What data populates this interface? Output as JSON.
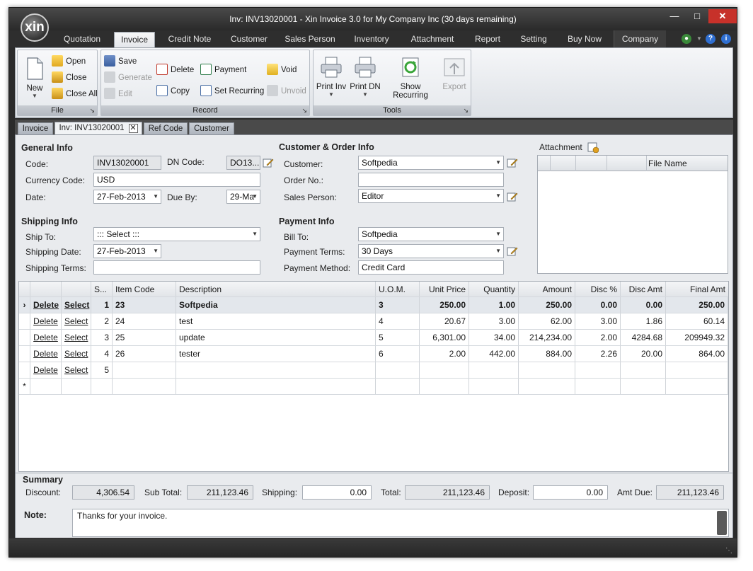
{
  "window": {
    "title": "Inv: INV13020001 - Xin Invoice 3.0 for My Company Inc (30 days remaining)",
    "logo_text": "xin"
  },
  "menu_tabs": [
    "Quotation",
    "Invoice",
    "Credit Note",
    "Customer",
    "Sales Person",
    "Inventory",
    "Attachment",
    "Report",
    "Setting",
    "Buy Now",
    "Company"
  ],
  "ribbon": {
    "file": {
      "label": "File",
      "new": "New",
      "open": "Open",
      "close": "Close",
      "close_all": "Close All"
    },
    "record": {
      "label": "Record",
      "save": "Save",
      "generate": "Generate",
      "edit": "Edit",
      "delete": "Delete",
      "copy": "Copy",
      "payment": "Payment",
      "set_recurring": "Set Recurring",
      "void": "Void",
      "unvoid": "Unvoid"
    },
    "tools": {
      "label": "Tools",
      "print_inv": "Print Inv",
      "print_dn": "Print DN",
      "show_recurring": "Show Recurring",
      "export": "Export"
    }
  },
  "doc_tabs": [
    "Invoice",
    "Inv: INV13020001",
    "Ref Code",
    "Customer"
  ],
  "general_info": {
    "title": "General Info",
    "code_label": "Code:",
    "code": "INV13020001",
    "dn_code_label": "DN Code:",
    "dn_code": "DO13...",
    "currency_label": "Currency Code:",
    "currency": "USD",
    "date_label": "Date:",
    "date": "27-Feb-2013",
    "due_by_label": "Due By:",
    "due_by": "29-Ma"
  },
  "shipping_info": {
    "title": "Shipping Info",
    "ship_to_label": "Ship To:",
    "ship_to": "::: Select :::",
    "shipping_date_label": "Shipping Date:",
    "shipping_date": "27-Feb-2013",
    "shipping_terms_label": "Shipping Terms:",
    "shipping_terms": ""
  },
  "customer_order": {
    "title": "Customer & Order Info",
    "customer_label": "Customer:",
    "customer": "Softpedia",
    "order_no_label": "Order No.:",
    "order_no": "",
    "sales_person_label": "Sales Person:",
    "sales_person": "Editor"
  },
  "payment_info": {
    "title": "Payment Info",
    "bill_to_label": "Bill To:",
    "bill_to": "Softpedia",
    "payment_terms_label": "Payment Terms:",
    "payment_terms": "30 Days",
    "payment_method_label": "Payment Method:",
    "payment_method": "Credit Card"
  },
  "attachment": {
    "label": "Attachment",
    "file_name_col": "File Name"
  },
  "grid": {
    "columns": [
      "",
      "",
      "",
      "S...",
      "Item Code",
      "Description",
      "U.O.M.",
      "Unit Price",
      "Quantity",
      "Amount",
      "Disc %",
      "Disc Amt",
      "Final Amt"
    ],
    "delete_label": "Delete",
    "select_label": "Select",
    "rows": [
      {
        "seq": "1",
        "item_code": "23",
        "description": "Softpedia",
        "uom": "3",
        "unit_price": "250.00",
        "quantity": "1.00",
        "amount": "250.00",
        "disc_pct": "0.00",
        "disc_amt": "0.00",
        "final_amt": "250.00"
      },
      {
        "seq": "2",
        "item_code": "24",
        "description": "test",
        "uom": "4",
        "unit_price": "20.67",
        "quantity": "3.00",
        "amount": "62.00",
        "disc_pct": "3.00",
        "disc_amt": "1.86",
        "final_amt": "60.14"
      },
      {
        "seq": "3",
        "item_code": "25",
        "description": "update",
        "uom": "5",
        "unit_price": "6,301.00",
        "quantity": "34.00",
        "amount": "214,234.00",
        "disc_pct": "2.00",
        "disc_amt": "4284.68",
        "final_amt": "209949.32"
      },
      {
        "seq": "4",
        "item_code": "26",
        "description": "tester",
        "uom": "6",
        "unit_price": "2.00",
        "quantity": "442.00",
        "amount": "884.00",
        "disc_pct": "2.26",
        "disc_amt": "20.00",
        "final_amt": "864.00"
      },
      {
        "seq": "5",
        "item_code": "",
        "description": "",
        "uom": "",
        "unit_price": "",
        "quantity": "",
        "amount": "",
        "disc_pct": "",
        "disc_amt": "",
        "final_amt": ""
      }
    ],
    "new_row_marker": "*",
    "current_row_marker": "›"
  },
  "summary": {
    "title": "Summary",
    "discount_label": "Discount:",
    "discount": "4,306.54",
    "sub_total_label": "Sub Total:",
    "sub_total": "211,123.46",
    "shipping_label": "Shipping:",
    "shipping": "0.00",
    "total_label": "Total:",
    "total": "211,123.46",
    "deposit_label": "Deposit:",
    "deposit": "0.00",
    "amt_due_label": "Amt Due:",
    "amt_due": "211,123.46"
  },
  "note": {
    "label": "Note:",
    "text": "Thanks for your invoice."
  },
  "colors": {
    "chrome_dark": "#2b2b2b",
    "ribbon_bg": "#e6e9ed",
    "close_red": "#c7312a",
    "content_bg": "#e9ebee"
  }
}
